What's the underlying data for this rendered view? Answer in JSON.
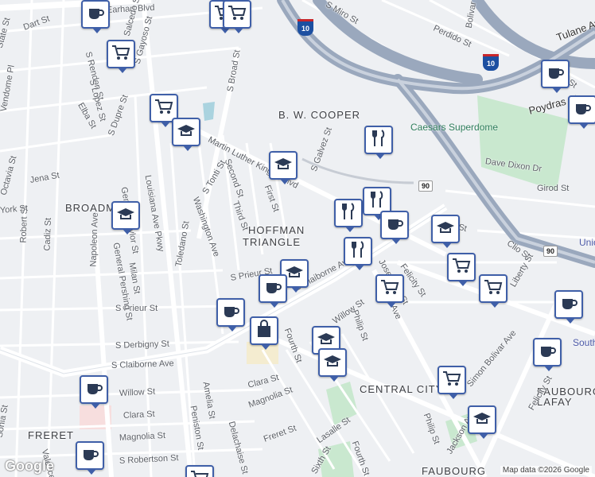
{
  "map": {
    "areas": [
      "B. W. COOPER",
      "HOFFMAN",
      "TRIANGLE",
      "BROADMOOR",
      "CENTRAL CITY",
      "FRERET",
      "FAUBOURG",
      "LAFAY",
      "FAUBOURG"
    ],
    "streets": [
      "Earhart Blvd",
      "S Broad St",
      "Martin Luther King Jr Blvd",
      "S Galvez St",
      "Second St",
      "First St",
      "Third St",
      "S Tonti St",
      "Washington Ave",
      "Toledano St",
      "Louisiana Ave Pkwy",
      "Napoleon Ave",
      "S Claiborne Ave",
      "S Prieur St",
      "S Derbigny St",
      "Willow St",
      "Clara St",
      "Magnolia St",
      "Freret St",
      "Simon Bolivar Ave",
      "Jackson Ave",
      "Josephine St",
      "Felicity St",
      "Erato St",
      "Clio St",
      "Girod St",
      "Dave Dixon Dr",
      "Poydras St",
      "Tulane Ave",
      "Gravier St",
      "Perdido St",
      "S Gayoso St",
      "S Dupre St",
      "Elba St",
      "Jena St",
      "Octavia St",
      "Robert St",
      "Cadiz St",
      "Milan St",
      "General Taylor St",
      "Peniston St",
      "Amelia St",
      "Philip St",
      "Fourth St",
      "Lasalle St",
      "Sixth St",
      "S Rendon St",
      "Salcedo St",
      "S Lopez St",
      "State St",
      "Dart St",
      "Vendome Pl",
      "York St",
      "Liberty St",
      "Clio St",
      "S Robertson St",
      "Delachaise St",
      "General Pershing St",
      "Bolivar St",
      "Sonia St",
      "Valence St",
      "S Miro St"
    ],
    "landmarks": [
      "Caesars Superdome",
      "South Beve",
      "Unio Term"
    ],
    "shields": {
      "interstate": "10",
      "us": "90",
      "bus": "90"
    },
    "attribution": "Map data ©2026 Google",
    "logo": "Google"
  },
  "markers": [
    {
      "type": "coffee"
    },
    {
      "type": "grocery"
    },
    {
      "type": "grocery"
    },
    {
      "type": "grocery"
    },
    {
      "type": "grocery"
    },
    {
      "type": "school"
    },
    {
      "type": "school"
    },
    {
      "type": "school"
    },
    {
      "type": "restaurant"
    },
    {
      "type": "restaurant"
    },
    {
      "type": "restaurant"
    },
    {
      "type": "coffee"
    },
    {
      "type": "school"
    },
    {
      "type": "grocery"
    },
    {
      "type": "grocery"
    },
    {
      "type": "grocery"
    },
    {
      "type": "coffee"
    },
    {
      "type": "coffee"
    },
    {
      "type": "school"
    },
    {
      "type": "restaurant"
    },
    {
      "type": "coffee"
    },
    {
      "type": "shopping"
    },
    {
      "type": "school"
    },
    {
      "type": "school"
    },
    {
      "type": "grocery"
    },
    {
      "type": "school"
    },
    {
      "type": "coffee"
    },
    {
      "type": "coffee"
    },
    {
      "type": "coffee"
    },
    {
      "type": "coffee"
    },
    {
      "type": "grocery"
    },
    {
      "type": "coffee"
    }
  ]
}
